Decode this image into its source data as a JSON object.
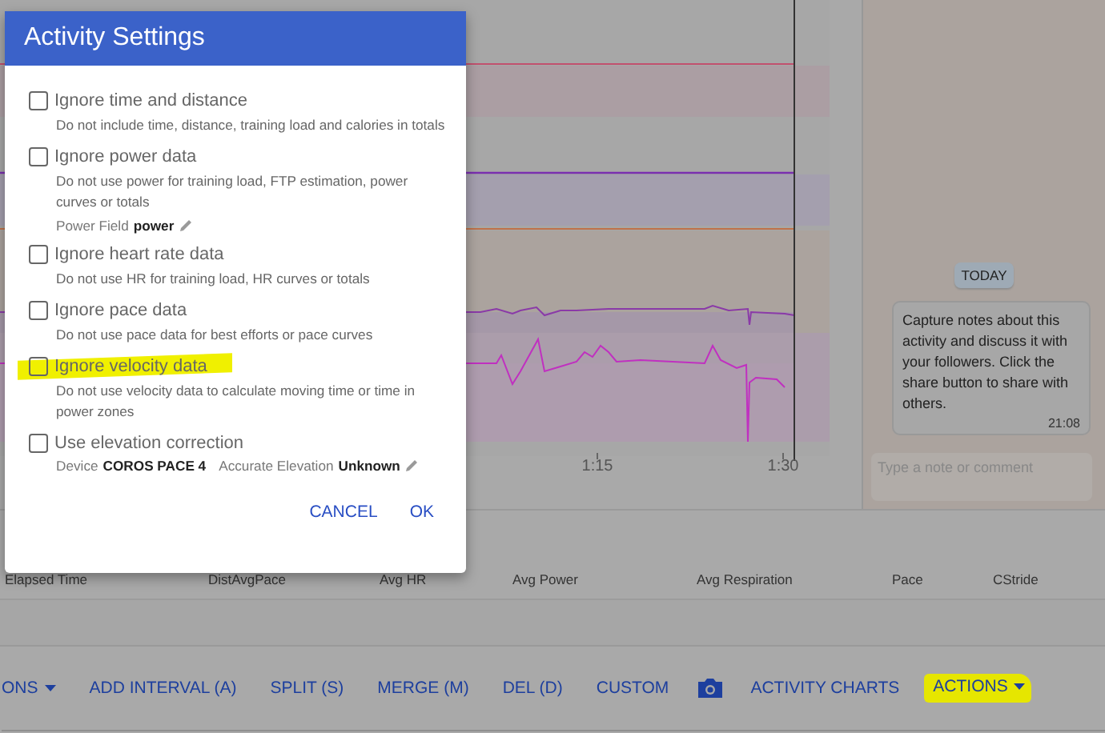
{
  "dialog": {
    "title": "Activity Settings",
    "options": [
      {
        "label": "Ignore time and distance",
        "description": "Do not include time, distance, training load and calories in totals",
        "checked": false,
        "highlighted": false
      },
      {
        "label": "Ignore power data",
        "description": "Do not use power for training load, FTP estimation, power curves or totals",
        "checked": false,
        "highlighted": false,
        "fields": [
          {
            "label": "Power Field",
            "value": "power",
            "editable": true
          }
        ]
      },
      {
        "label": "Ignore heart rate data",
        "description": "Do not use HR for training load, HR curves or totals",
        "checked": false,
        "highlighted": false
      },
      {
        "label": "Ignore pace data",
        "description": "Do not use pace data for best efforts or pace curves",
        "checked": false,
        "highlighted": false
      },
      {
        "label": "Ignore velocity data",
        "description": "Do not use velocity data to calculate moving time or time in power zones",
        "checked": false,
        "highlighted": true
      },
      {
        "label": "Use elevation correction",
        "checked": false,
        "highlighted": false,
        "fields": [
          {
            "label": "Device",
            "value": "COROS PACE 4",
            "editable": false
          },
          {
            "label": "Accurate Elevation",
            "value": "Unknown",
            "editable": true
          }
        ]
      }
    ],
    "buttons": [
      "CANCEL",
      "OK"
    ]
  },
  "chart": {
    "tick_labels": [
      "1:15",
      "1:30"
    ]
  },
  "notes": {
    "date_badge": "TODAY",
    "message": {
      "text": "Capture notes about this activity and discuss it with your followers. Click the share button to share with others.",
      "time": "21:08"
    },
    "comment_field": {
      "placeholder": "Type a note or comment"
    }
  },
  "table": {
    "columns": [
      "Elapsed Time",
      "DistAvgPace",
      "Avg HR",
      "Avg Power",
      "Avg Respiration",
      "Pace",
      "CStride"
    ]
  },
  "toolbar": [
    {
      "kind": "dropdown",
      "label": "ONS",
      "highlighted": false
    },
    {
      "kind": "button",
      "label": "ADD INTERVAL (A)",
      "highlighted": false
    },
    {
      "kind": "button",
      "label": "SPLIT (S)",
      "highlighted": false
    },
    {
      "kind": "button",
      "label": "MERGE (M)",
      "highlighted": false
    },
    {
      "kind": "button",
      "label": "DEL (D)",
      "highlighted": false
    },
    {
      "kind": "button",
      "label": "CUSTOM",
      "highlighted": false
    },
    {
      "kind": "camera"
    },
    {
      "kind": "button",
      "label": "ACTIVITY CHARTS",
      "highlighted": false
    },
    {
      "kind": "dropdown",
      "label": "ACTIONS",
      "highlighted": true
    }
  ]
}
